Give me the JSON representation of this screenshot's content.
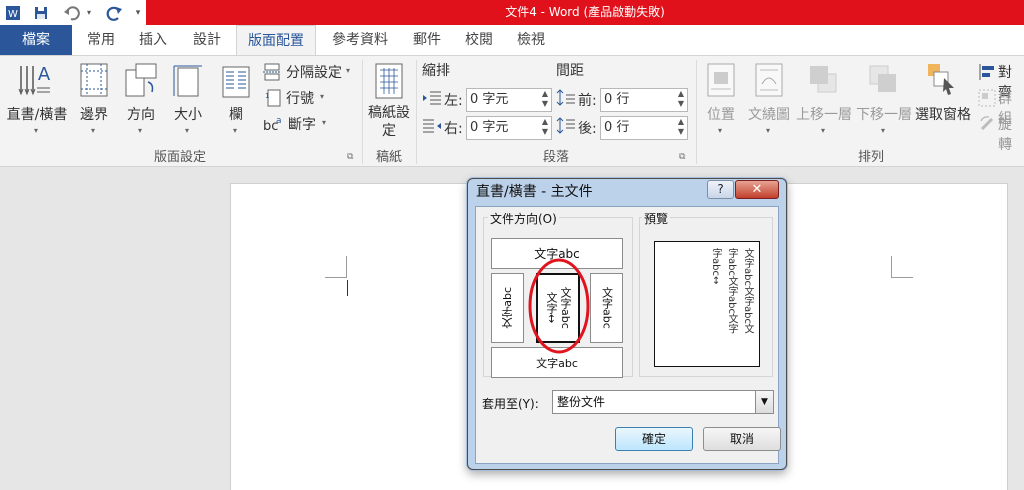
{
  "window": {
    "title": "文件4 - Word (產品啟動失敗)"
  },
  "quick_access": [
    "W",
    "save",
    "undo",
    "redo",
    "customize"
  ],
  "tabs": [
    {
      "label": "檔案"
    },
    {
      "label": "常用"
    },
    {
      "label": "插入"
    },
    {
      "label": "設計"
    },
    {
      "label": "版面配置"
    },
    {
      "label": "參考資料"
    },
    {
      "label": "郵件"
    },
    {
      "label": "校閱"
    },
    {
      "label": "檢視"
    }
  ],
  "ribbon": {
    "page_setup": {
      "group_label": "版面設定",
      "text_direction": "直書/橫書",
      "margins": "邊界",
      "orientation": "方向",
      "size": "大小",
      "columns": "欄",
      "breaks": "分隔設定",
      "line_numbers": "行號",
      "hyphenation": "斷字"
    },
    "draft": {
      "group_label": "稿紙",
      "button": "稿紙設定"
    },
    "paragraph": {
      "group_label": "段落",
      "indent_heading": "縮排",
      "spacing_heading": "間距",
      "left_label": "左:",
      "left_value": "0 字元",
      "right_label": "右:",
      "right_value": "0 字元",
      "before_label": "前:",
      "before_value": "0 行",
      "after_label": "後:",
      "after_value": "0 行"
    },
    "arrange": {
      "group_label": "排列",
      "position": "位置",
      "wrap_text": "文繞圖",
      "bring_forward": "上移一層",
      "send_backward": "下移一層",
      "selection_pane": "選取窗格",
      "align": "對齊",
      "group": "群組",
      "rotate": "旋轉"
    }
  },
  "dialog": {
    "title": "直書/橫書 - 主文件",
    "help": "?",
    "close": "✕",
    "orientation_label": "文件方向(O)",
    "preview_label": "預覽",
    "options": {
      "horizontal": "文字abc",
      "vertical_right_to_left": "文字abc",
      "vertical_marked_a": "文字↔",
      "rotated_left": "文字abc",
      "rotated_right": "文字abc",
      "upside_down": "文字abc"
    },
    "preview_cols": [
      "文字abc文字abc文",
      "字abc文字abc文字",
      "字abc↔"
    ],
    "apply_label": "套用至(Y):",
    "apply_value": "整份文件",
    "ok": "確定",
    "cancel": "取消",
    "highlight_color": "#e0141e"
  },
  "colors": {
    "accent": "#2b579a",
    "titlebar": "#e0111b"
  }
}
